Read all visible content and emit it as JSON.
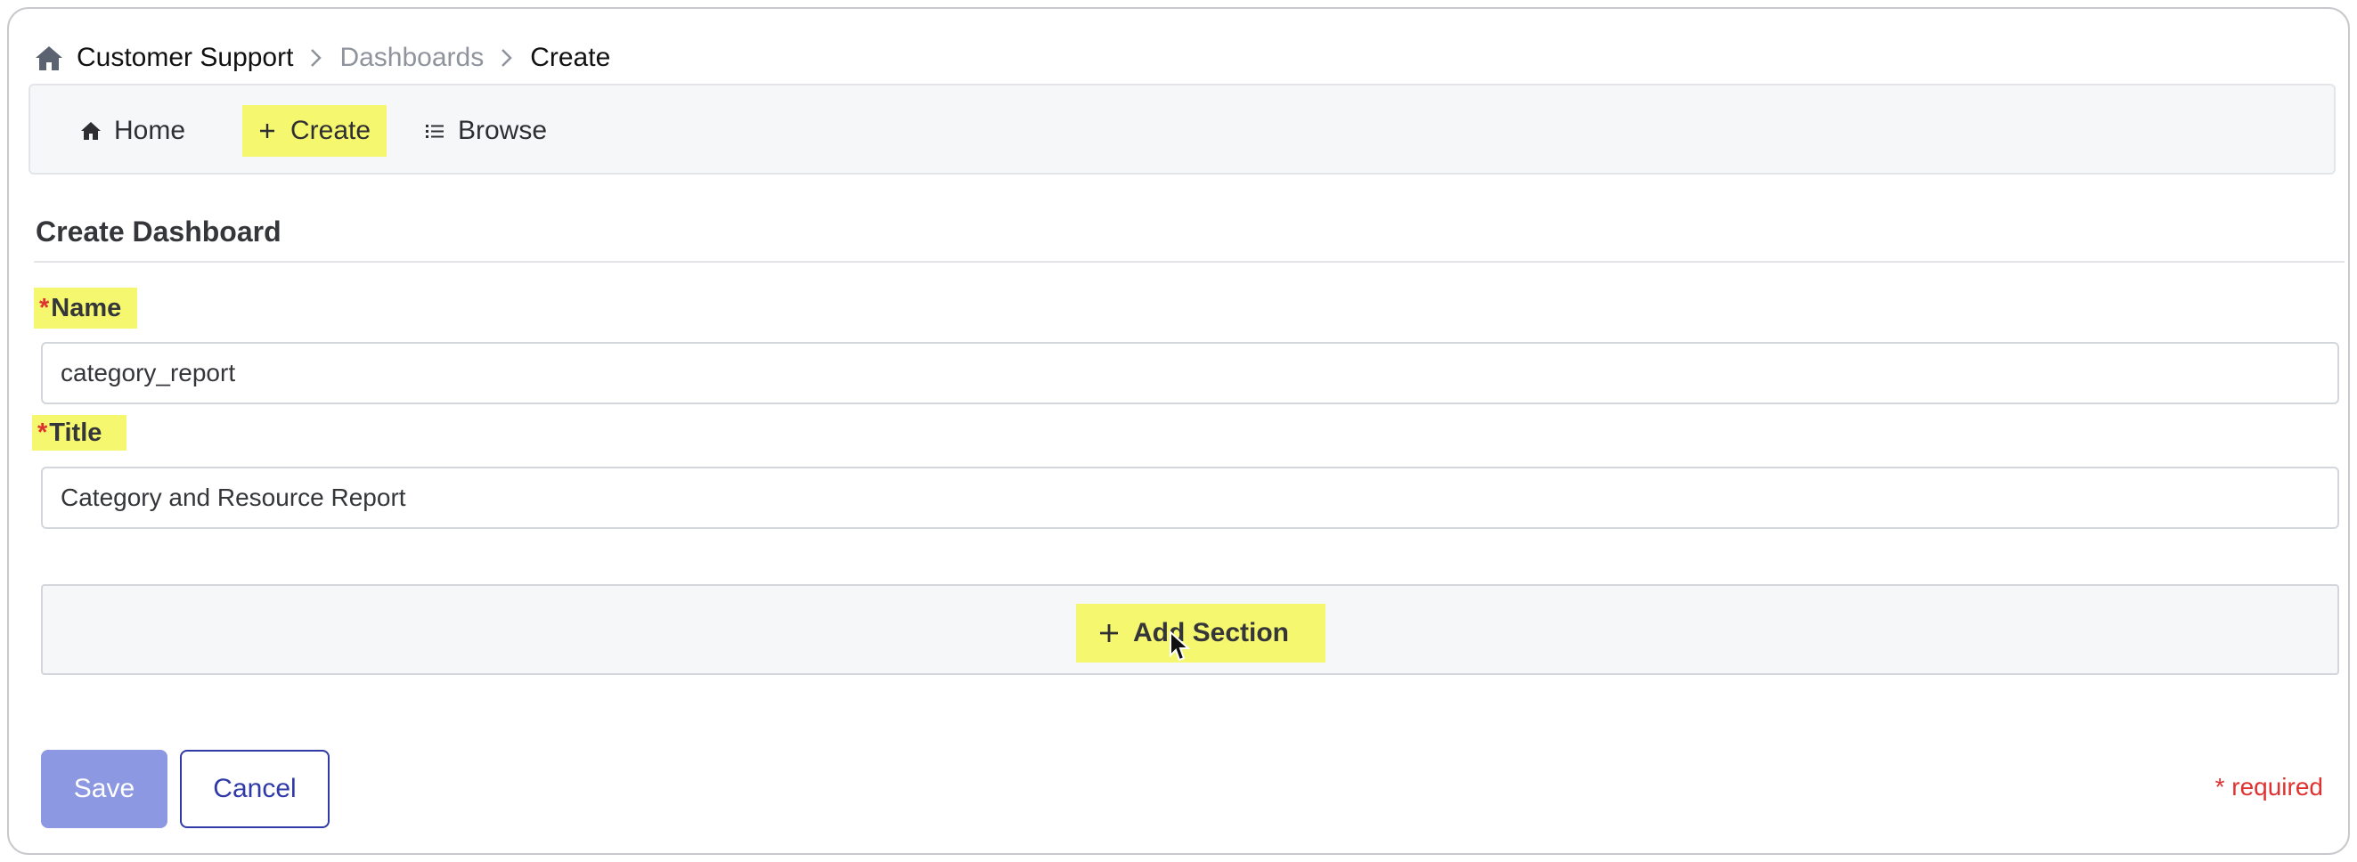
{
  "breadcrumb": {
    "items": [
      "Customer Support",
      "Dashboards",
      "Create"
    ]
  },
  "nav": {
    "home_label": "Home",
    "create_label": "Create",
    "browse_label": "Browse"
  },
  "page": {
    "title": "Create Dashboard"
  },
  "form": {
    "name_label": "Name",
    "name_value": "category_report",
    "title_label": "Title",
    "title_value": "Category and Resource Report",
    "required_marker": "*",
    "add_section_label": "Add Section"
  },
  "footer": {
    "save_label": "Save",
    "cancel_label": "Cancel",
    "required_note": "* required"
  },
  "icons": {
    "breadcrumb_home": "home-icon",
    "breadcrumb_separator": "chevron-right-icon",
    "nav_home": "home-icon",
    "nav_create": "plus-icon",
    "nav_browse": "list-icon",
    "add_section": "plus-icon",
    "cursor": "mouse-pointer-icon"
  },
  "colors": {
    "highlight": "#f5f76e",
    "save_button": "#8c98e2",
    "cancel_border": "#2f3aa8",
    "required": "#e03131"
  }
}
